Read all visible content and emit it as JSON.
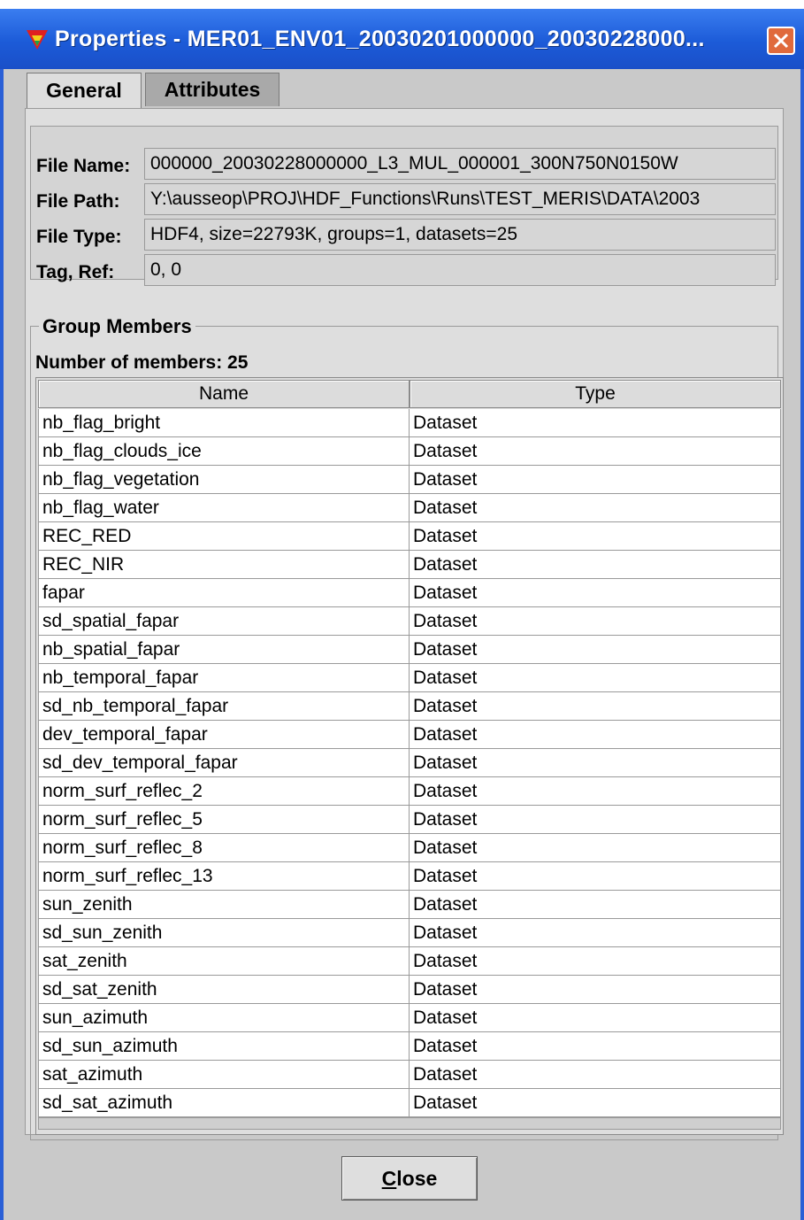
{
  "window": {
    "title": "Properties - MER01_ENV01_20030201000000_20030228000...",
    "accent_color": "#1c5bd8",
    "close_icon": "close-icon"
  },
  "tabs": [
    {
      "label": "General",
      "active": true
    },
    {
      "label": "Attributes",
      "active": false
    }
  ],
  "info": {
    "file_name_label": "File Name:",
    "file_name_value": "000000_20030228000000_L3_MUL_000001_300N750N0150W",
    "file_path_label": "File Path:",
    "file_path_value": "Y:\\ausseop\\PROJ\\HDF_Functions\\Runs\\TEST_MERIS\\DATA\\2003",
    "file_type_label": "File Type:",
    "file_type_value": "HDF4,  size=22793K,  groups=1,  datasets=25",
    "tag_ref_label": "Tag, Ref:",
    "tag_ref_value": "0, 0"
  },
  "group": {
    "title": "Group Members",
    "count_label": "Number of members: 25",
    "columns": [
      "Name",
      "Type"
    ],
    "rows": [
      [
        "nb_flag_bright",
        "Dataset"
      ],
      [
        "nb_flag_clouds_ice",
        "Dataset"
      ],
      [
        "nb_flag_vegetation",
        "Dataset"
      ],
      [
        "nb_flag_water",
        "Dataset"
      ],
      [
        "REC_RED",
        "Dataset"
      ],
      [
        "REC_NIR",
        "Dataset"
      ],
      [
        "fapar",
        "Dataset"
      ],
      [
        "sd_spatial_fapar",
        "Dataset"
      ],
      [
        "nb_spatial_fapar",
        "Dataset"
      ],
      [
        "nb_temporal_fapar",
        "Dataset"
      ],
      [
        "sd_nb_temporal_fapar",
        "Dataset"
      ],
      [
        "dev_temporal_fapar",
        "Dataset"
      ],
      [
        "sd_dev_temporal_fapar",
        "Dataset"
      ],
      [
        "norm_surf_reflec_2",
        "Dataset"
      ],
      [
        "norm_surf_reflec_5",
        "Dataset"
      ],
      [
        "norm_surf_reflec_8",
        "Dataset"
      ],
      [
        "norm_surf_reflec_13",
        "Dataset"
      ],
      [
        "sun_zenith",
        "Dataset"
      ],
      [
        "sd_sun_zenith",
        "Dataset"
      ],
      [
        "sat_zenith",
        "Dataset"
      ],
      [
        "sd_sat_zenith",
        "Dataset"
      ],
      [
        "sun_azimuth",
        "Dataset"
      ],
      [
        "sd_sun_azimuth",
        "Dataset"
      ],
      [
        "sat_azimuth",
        "Dataset"
      ],
      [
        "sd_sat_azimuth",
        "Dataset"
      ]
    ]
  },
  "footer": {
    "close_label_mnemonic": "C",
    "close_label_rest": "lose"
  }
}
